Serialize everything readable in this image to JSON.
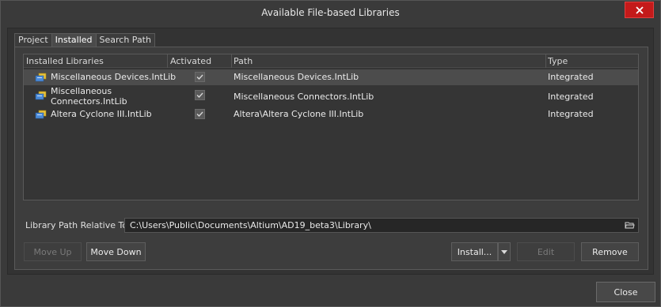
{
  "window": {
    "title": "Available File-based Libraries"
  },
  "tabs": [
    {
      "label": "Project"
    },
    {
      "label": "Installed"
    },
    {
      "label": "Search Path"
    }
  ],
  "grid": {
    "columns": [
      "Installed Libraries",
      "Activated",
      "Path",
      "Type"
    ],
    "rows": [
      {
        "name": "Miscellaneous Devices.IntLib",
        "name_line2": "",
        "activated": true,
        "path": "Miscellaneous Devices.IntLib",
        "type": "Integrated"
      },
      {
        "name": "Miscellaneous",
        "name_line2": "Connectors.IntLib",
        "activated": true,
        "path": "Miscellaneous Connectors.IntLib",
        "type": "Integrated"
      },
      {
        "name": "Altera Cyclone III.IntLib",
        "name_line2": "",
        "activated": true,
        "path": "Altera\\Altera Cyclone III.IntLib",
        "type": "Integrated"
      }
    ]
  },
  "library_path": {
    "label": "Library Path Relative To:",
    "value": "C:\\Users\\Public\\Documents\\Altium\\AD19_beta3\\Library\\"
  },
  "buttons": {
    "move_up": "Move Up",
    "move_down": "Move Down",
    "install": "Install...",
    "edit": "Edit",
    "remove": "Remove",
    "close": "Close"
  },
  "icons": {
    "close": "close-icon",
    "library": "integrated-library-icon",
    "folder": "folder-open-icon",
    "dropdown": "chevron-down-icon",
    "check": "checkmark-icon"
  },
  "colors": {
    "close_button": "#c41a1a",
    "window_bg": "#3a3a3a",
    "selected_row": "#4c4c4c"
  }
}
